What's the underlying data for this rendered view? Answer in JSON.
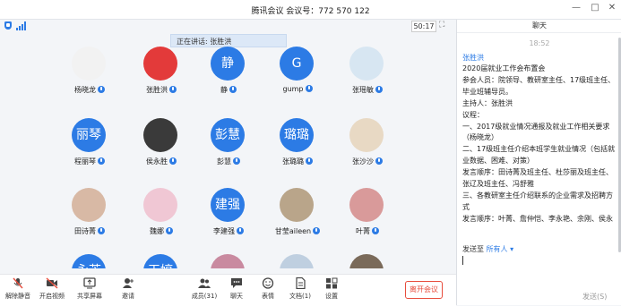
{
  "window": {
    "title": "腾讯会议  会议号：772 570 122"
  },
  "window_controls": [
    "—",
    "□",
    "✕"
  ],
  "info": {
    "timer": "50:17"
  },
  "speaking_banner": "正在讲话: 张胜洪",
  "participants": [
    {
      "name": "杨晓龙",
      "avatar_text": "",
      "photo": "#f2f2f2"
    },
    {
      "name": "张胜洪",
      "avatar_text": "",
      "photo": "#e33a3a"
    },
    {
      "name": "静",
      "avatar_text": "静",
      "photo": ""
    },
    {
      "name": "gump",
      "avatar_text": "G",
      "photo": ""
    },
    {
      "name": "张瑶敏",
      "avatar_text": "",
      "photo": "#d7e6f2"
    },
    {
      "name": "程丽琴",
      "avatar_text": "丽琴",
      "photo": ""
    },
    {
      "name": "侯永胜",
      "avatar_text": "",
      "photo": "#3a3a3a"
    },
    {
      "name": "彭慧",
      "avatar_text": "彭慧",
      "photo": ""
    },
    {
      "name": "张璐璐",
      "avatar_text": "璐璐",
      "photo": ""
    },
    {
      "name": "张沙沙",
      "avatar_text": "",
      "photo": "#e8d9c4"
    },
    {
      "name": "田诗菁",
      "avatar_text": "",
      "photo": "#d8b9a5"
    },
    {
      "name": "魏娜",
      "avatar_text": "",
      "photo": "#f0c7d4"
    },
    {
      "name": "李建强",
      "avatar_text": "建强",
      "photo": ""
    },
    {
      "name": "甘莹aileen",
      "avatar_text": "",
      "photo": "#b9a58a"
    },
    {
      "name": "叶菁",
      "avatar_text": "",
      "photo": "#d99a9a"
    },
    {
      "name": "",
      "avatar_text": "永芳",
      "photo": ""
    },
    {
      "name": "",
      "avatar_text": "玉婷",
      "photo": ""
    },
    {
      "name": "",
      "avatar_text": "",
      "photo": "#c98aa0"
    },
    {
      "name": "",
      "avatar_text": "",
      "photo": "#bfcfe0"
    },
    {
      "name": "",
      "avatar_text": "",
      "photo": "#7a6a5a"
    }
  ],
  "toolbar": {
    "items": [
      {
        "label": "解除静音",
        "icon": "mic-muted-icon"
      },
      {
        "label": "开启视频",
        "icon": "video-off-icon"
      },
      {
        "label": "共享屏幕",
        "icon": "share-screen-icon"
      },
      {
        "label": "邀请",
        "icon": "invite-icon"
      },
      {
        "label": "成员(31)",
        "icon": "members-icon"
      },
      {
        "label": "聊天",
        "icon": "chat-icon"
      },
      {
        "label": "表情",
        "icon": "emoji-icon"
      },
      {
        "label": "文档(1)",
        "icon": "document-icon"
      },
      {
        "label": "设置",
        "icon": "settings-icon"
      }
    ],
    "leave_label": "离开会议"
  },
  "chat": {
    "header": "聊天",
    "time": "18:52",
    "sender": "张胜洪",
    "lines": [
      "2020届就业工作会布置会",
      "参会人员：院领导、教研室主任、17级班主任、",
      "毕业班辅导员。",
      "主持人：张胜洪",
      "议程：",
      "一、2017级就业情况通报及就业工作相关要求",
      "（杨晓龙）",
      "二、17级班主任介绍本班学生就业情况（包括就",
      "业数据、困难、对策）",
      "发言顺序：田诗菁及班主任、杜莎丽及班主任、",
      "张辽及班主任、冯舒雅",
      "三、各教研室主任介绍联系的企业需求及招聘方",
      "式",
      "发言顺序：叶菁、詹仲恺、李永艳、余刚、侯永"
    ],
    "send_to_label": "发送至",
    "send_to_target": "所有人",
    "send_button": "发送(S)"
  }
}
